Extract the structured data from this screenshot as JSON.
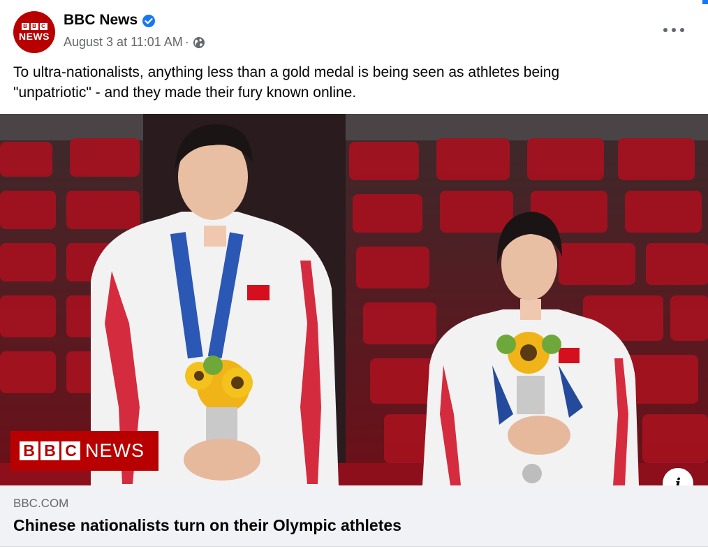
{
  "post": {
    "page_name": "BBC News",
    "avatar_blocks": [
      "B",
      "B",
      "C"
    ],
    "avatar_news": "NEWS",
    "date": "August 3 at 11:01 AM",
    "separator": "·",
    "privacy_icon": "globe-icon",
    "verified_icon": "verified-badge-icon",
    "more_icon": "more-options-icon",
    "text_line1": "To ultra-nationalists, anything less than a gold medal is being seen as athletes being",
    "text_line2": "\"unpatriotic\" - and they made their fury known online."
  },
  "photo": {
    "watermark_blocks": [
      "B",
      "B",
      "C"
    ],
    "watermark_news": "NEWS",
    "info_label": "i"
  },
  "link": {
    "domain": "BBC.COM",
    "headline": "Chinese nationalists turn on their Olympic athletes"
  },
  "colors": {
    "bbc_red": "#b80000",
    "verified_blue": "#1877f2",
    "meta_gray": "#65676b",
    "link_bg": "#f0f2f5"
  }
}
